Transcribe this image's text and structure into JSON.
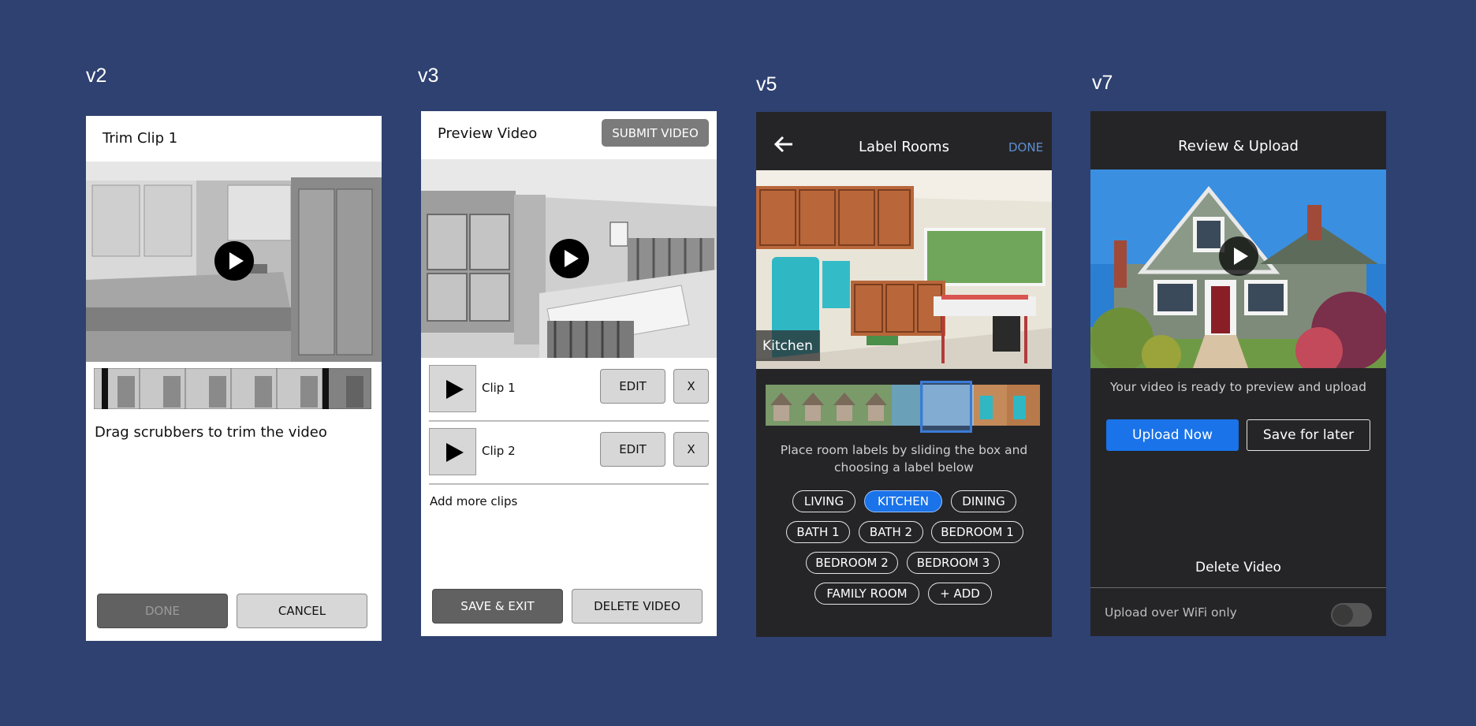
{
  "versions": [
    "v2",
    "v3",
    "v5",
    "v7"
  ],
  "v2": {
    "title": "Trim Clip 1",
    "hint": "Drag scrubbers to trim the video",
    "done_label": "DONE",
    "cancel_label": "CANCEL"
  },
  "v3": {
    "title": "Preview Video",
    "submit_label": "SUBMIT VIDEO",
    "clips": [
      {
        "name": "Clip 1",
        "edit_label": "EDIT",
        "remove_label": "X"
      },
      {
        "name": "Clip 2",
        "edit_label": "EDIT",
        "remove_label": "X"
      }
    ],
    "add_more": "Add more clips",
    "save_exit_label": "SAVE & EXIT",
    "delete_label": "DELETE VIDEO"
  },
  "v5": {
    "title": "Label Rooms",
    "done_label": "DONE",
    "current_room": "Kitchen",
    "hint": "Place room labels by sliding the box and choosing a label below",
    "chips": [
      "LIVING",
      "KITCHEN",
      "DINING",
      "BATH 1",
      "BATH 2",
      "BEDROOM 1",
      "BEDROOM 2",
      "BEDROOM 3",
      "FAMILY ROOM",
      "+ ADD"
    ],
    "selected_chip": "KITCHEN"
  },
  "v7": {
    "title": "Review & Upload",
    "message": "Your video is ready to preview and upload",
    "upload_label": "Upload Now",
    "later_label": "Save for later",
    "delete_label": "Delete Video",
    "wifi_label": "Upload over WiFi only",
    "wifi_only": false
  },
  "colors": {
    "background": "#2e4170",
    "accent": "#1a73e8",
    "dark_panel": "#252528"
  }
}
